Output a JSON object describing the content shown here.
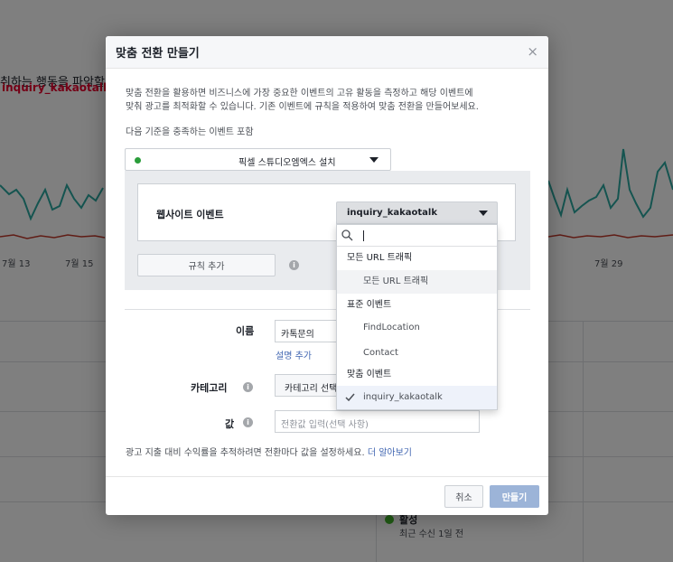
{
  "background": {
    "heading": "취하는 행동을 파악할",
    "event_name": "inquiry_kakaotalk",
    "axis_ticks": [
      "7월 13",
      "7월 15",
      "7월 29"
    ],
    "status_label": "활성",
    "status_sub": "최근 수신 1일 전",
    "colors": {
      "line_teal": "#2aa9a1",
      "line_red": "#c0392b",
      "status_green": "#42b72a"
    }
  },
  "modal": {
    "title": "맞춤 전환 만들기",
    "close_glyph": "×",
    "intro_line1": "맞춤 전환을 활용하면 비즈니스에 가장 중요한 이벤트의 고유 활동을 측정하고 해당 이벤트에",
    "intro_line2": "맞춰 광고를 최적화할 수 있습니다. 기존 이벤트에 규칙을 적용하여 맞춤 전환을 만들어보세요.",
    "criteria_label": "다음 기준을 충족하는 이벤트 포함",
    "pixel_name": "픽셀 스튜디오엠엑스 설치",
    "rule_label": "웹사이트 이벤트",
    "add_rule": "규칙 추가",
    "name_label": "이름",
    "name_value": "카톡문의",
    "add_description": "설명 추가",
    "category_label": "카테고리",
    "category_placeholder": "카테고리 선택",
    "value_label": "값",
    "value_placeholder": "전환값 입력(선택 사항)",
    "roi_text": "광고 지출 대비 수익률을 추적하려면 전환마다 값을 설정하세요.",
    "learn_more": "더 알아보기",
    "cancel": "취소",
    "create": "만들기",
    "info_glyph": "i",
    "colors": {
      "accent": "#4267b2",
      "create_disabled": "#9cb4d8",
      "pixel_active": "#2a9d3a"
    }
  },
  "event_dropdown": {
    "selected": "inquiry_kakaotalk",
    "search_value": "",
    "groups": [
      {
        "label": "모든 URL 트래픽",
        "options": [
          "모든 URL 트래픽"
        ]
      },
      {
        "label": "표준 이벤트",
        "options": [
          "FindLocation",
          "Contact"
        ]
      },
      {
        "label": "맞춤 이벤트",
        "options": [
          "inquiry_kakaotalk"
        ]
      }
    ]
  }
}
